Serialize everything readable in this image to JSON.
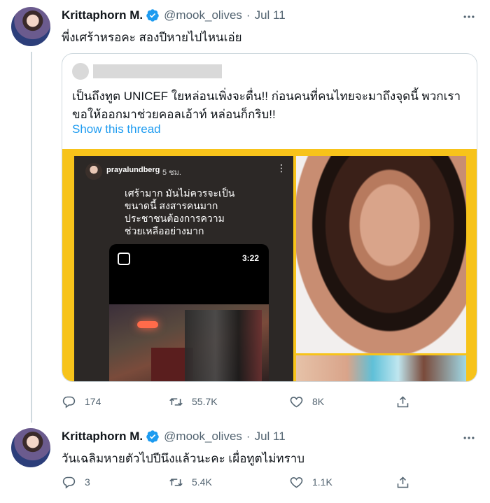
{
  "tweets": [
    {
      "author_name": "Krittaphorn M.",
      "handle": "@mook_olives",
      "separator": "·",
      "date": "Jul 11",
      "text": "พี่งเศร้าหรอคะ สองปีหายไปไหนเอ่ย",
      "quote": {
        "text": "เป็นถึงทูต UNICEF ใยหล่อนเพิ่งจะตื่น!!  ก่อนคนที่คนไทยจะมาถึงจุดนี้ พวกเราขอให้ออกมาช่วยคอลเอ้าท์ หล่อนก็กริบ!!",
        "link": "Show this thread",
        "story": {
          "username": "prayalundberg",
          "time": "5 ชม.",
          "caption": "เศร้ามาก มันไม่ควรจะเป็น\nขนาดนี้ สงสารคนมาก\nประชาชนต้องการความ\nช่วยเหลืออย่างมาก",
          "video_duration": "3:22"
        }
      },
      "stats": {
        "replies": "174",
        "retweets": "55.7K",
        "likes": "8K"
      }
    },
    {
      "author_name": "Krittaphorn M.",
      "handle": "@mook_olives",
      "separator": "·",
      "date": "Jul 11",
      "text": "วันเฉลิมหายตัวไปปีนึงแล้วนะคะ เผื่อทูตไม่ทราบ",
      "stats": {
        "replies": "3",
        "retweets": "5.4K",
        "likes": "1.1K"
      }
    }
  ],
  "icons": {
    "verified": "verified-badge-icon",
    "more": "more-dots-icon",
    "reply": "reply-icon",
    "retweet": "retweet-icon",
    "like": "heart-icon",
    "share": "share-icon"
  },
  "colors": {
    "verified": "#1d9bf0",
    "link": "#1d9bf0",
    "secondary_text": "#536471",
    "border": "#cfd9de",
    "media_frame": "#f7c31a"
  }
}
